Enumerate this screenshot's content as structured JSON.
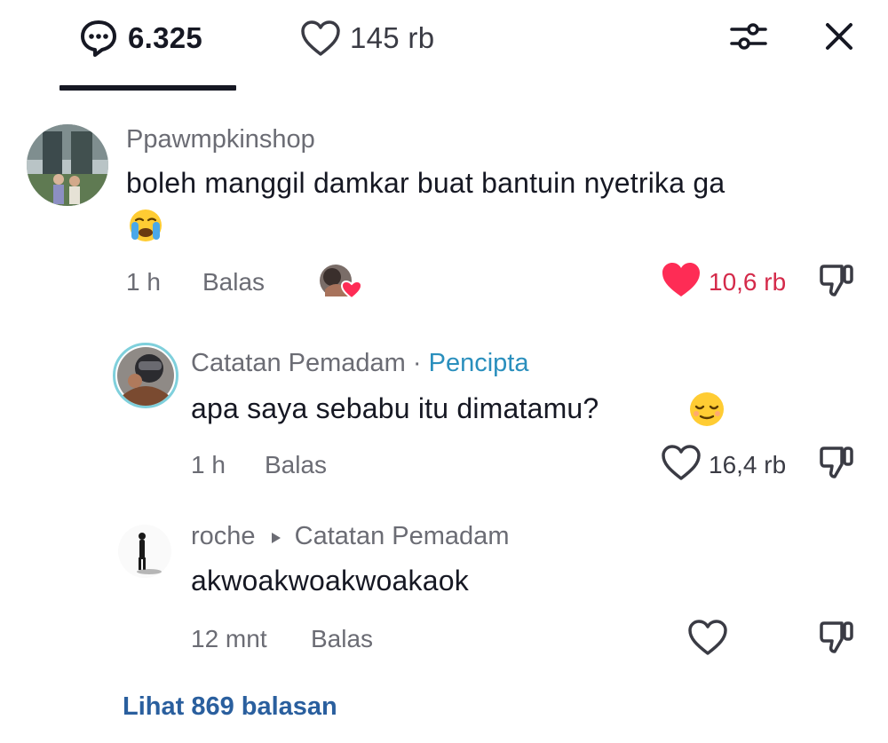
{
  "header": {
    "comments_count": "6.325",
    "likes_count": "145 rb",
    "icons": {
      "comments": "comment-bubble-icon",
      "likes": "heart-outline-icon",
      "filter": "sliders-icon",
      "close": "close-icon"
    }
  },
  "comments": [
    {
      "username": "Ppawmpkinshop",
      "text": "boleh manggil damkar buat bantuin nyetrika ga",
      "emoji": "crying-face-emoji",
      "time": "1 h",
      "reply_label": "Balas",
      "likes": "10,6 rb",
      "liked": true,
      "like_color": "#fe2c55",
      "creator_liked": true
    },
    {
      "username": "Catatan Pemadam",
      "separator": "·",
      "badge": "Pencipta",
      "text": "apa saya sebabu itu dimatamu?",
      "emoji": "relieved-face-emoji",
      "time": "1 h",
      "reply_label": "Balas",
      "likes": "16,4 rb",
      "liked": false
    },
    {
      "username": "roche",
      "reply_to": "Catatan Pemadam",
      "text": "akwoakwoakwoakaok",
      "time": "12 mnt",
      "reply_label": "Balas",
      "likes": "",
      "liked": false
    }
  ],
  "view_replies_label": "Lihat 869 balasan",
  "colors": {
    "accent_link": "#2a5f9e",
    "creator_badge": "#2a8fbd",
    "like_red": "#fe2c55",
    "text_primary": "#161823",
    "text_secondary": "#6b6c74"
  }
}
